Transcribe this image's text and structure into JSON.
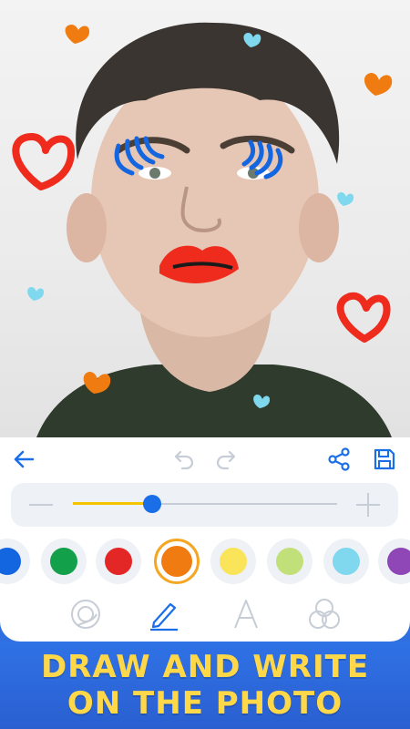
{
  "headline": {
    "line1": "DRAW AND WRITE",
    "line2": "ON THE PHOTO"
  },
  "toolbar": {
    "back_icon": "arrow-left-icon",
    "undo_icon": "undo-icon",
    "redo_icon": "redo-icon",
    "share_icon": "share-icon",
    "save_icon": "floppy-save-icon"
  },
  "brush_slider": {
    "value_fraction": 0.3,
    "accent": "#f5c400",
    "knob": "#1a6ee8"
  },
  "colors": [
    "#1466e0",
    "#13a04a",
    "#e32626",
    "#f07b10",
    "#f9e45a",
    "#c2e07a",
    "#7fd8ee",
    "#8f46b6"
  ],
  "selected_color_index": 3,
  "tools": [
    {
      "icon": "sticker-icon",
      "active": false
    },
    {
      "icon": "pen-icon",
      "active": true
    },
    {
      "icon": "text-icon",
      "active": false
    },
    {
      "icon": "blend-circles-icon",
      "active": false
    }
  ],
  "theme": {
    "accent": "#1a6ee8",
    "inactive": "#c7cdd6",
    "headline_bg": "#2f6fe0",
    "headline_text": "#ffd84a"
  }
}
